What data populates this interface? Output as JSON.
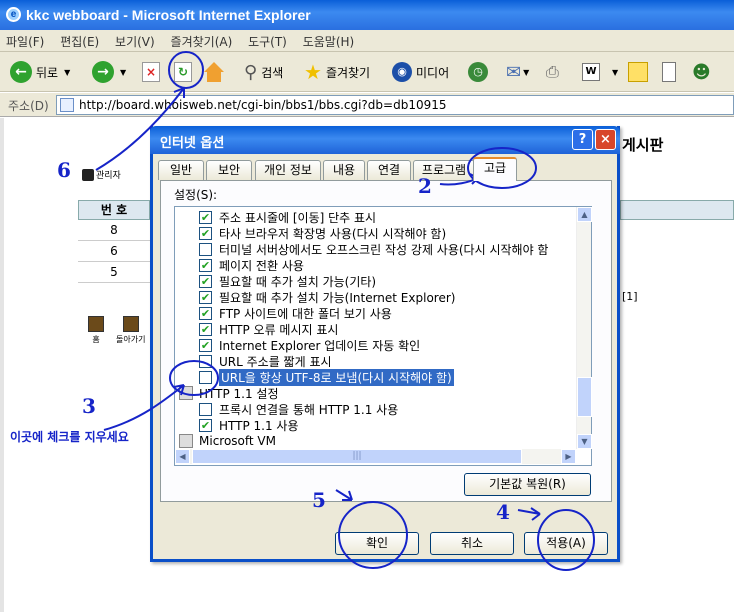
{
  "window": {
    "title": "kkc webboard - Microsoft Internet Explorer"
  },
  "menu": [
    "파일(F)",
    "편집(E)",
    "보기(V)",
    "즐겨찾기(A)",
    "도구(T)",
    "도움말(H)"
  ],
  "toolbar": {
    "back": "뒤로",
    "search": "검색",
    "favorites": "즐겨찾기",
    "media": "미디어"
  },
  "address": {
    "label": "주소(D)",
    "url": "http://board.whoisweb.net/cgi-bin/bbs1/bbs.cgi?db=db10915"
  },
  "page": {
    "board_title": "게시판",
    "admin_label": "관리자",
    "table_header": "번 호",
    "rows": [
      "8",
      "6",
      "5"
    ],
    "bracket": "[1]",
    "home_label": "홈",
    "back_label": "돌아가기"
  },
  "dialog": {
    "title": "인터넷 옵션",
    "help": "?",
    "close": "×",
    "tabs": [
      "일반",
      "보안",
      "개인 정보",
      "내용",
      "연결",
      "프로그램",
      "고급"
    ],
    "settings_label": "설정(S):",
    "items": [
      {
        "label": "주소 표시줄에 [이동] 단추 표시",
        "checked": true
      },
      {
        "label": "타사 브라우저 확장명 사용(다시 시작해야 함)",
        "checked": true
      },
      {
        "label": "터미널 서버상에서도 오프스크린 작성 강제 사용(다시 시작해야 함",
        "checked": false
      },
      {
        "label": "페이지 전환 사용",
        "checked": true
      },
      {
        "label": "필요할 때 추가 설치 가능(기타)",
        "checked": true
      },
      {
        "label": "필요할 때 추가 설치 가능(Internet Explorer)",
        "checked": true
      },
      {
        "label": "FTP 사이트에 대한 폴더 보기 사용",
        "checked": true
      },
      {
        "label": "HTTP 오류 메시지 표시",
        "checked": true
      },
      {
        "label": "Internet Explorer 업데이트 자동 확인",
        "checked": true
      },
      {
        "label": "URL 주소를 짧게 표시",
        "checked": false
      },
      {
        "label": "URL을 항상 UTF-8로 보냄(다시 시작해야 함)",
        "checked": false,
        "selected": true
      }
    ],
    "group_http": "HTTP 1.1 설정",
    "items2": [
      {
        "label": "프록시 연결을 통해 HTTP 1.1 사용",
        "checked": false
      },
      {
        "label": "HTTP 1.1 사용",
        "checked": true
      }
    ],
    "group_vm": "Microsoft VM",
    "restore_button": "기본값 복원(R)",
    "ok_button": "확인",
    "cancel_button": "취소",
    "apply_button": "적용(A)"
  },
  "annotations": {
    "n2": "2",
    "n3": "3",
    "n4": "4",
    "n5": "5",
    "n6": "6",
    "note": "이곳에 체크를 지우세요"
  },
  "colors": {
    "annotation": "#1624c8",
    "selection": "#316ac5",
    "titlebar": "#0a5fd8"
  }
}
